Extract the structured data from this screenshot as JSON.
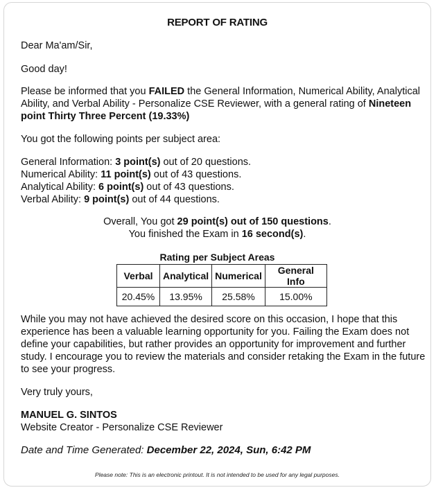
{
  "title": "REPORT OF RATING",
  "salutation": "Dear Ma'am/Sir,",
  "greeting": "Good day!",
  "intro": {
    "pre": "Please be informed that you ",
    "status": "FAILED",
    "mid": " the General Information, Numerical Ability, Analytical Ability, and Verbal Ability - Personalize CSE Reviewer, with a general rating of ",
    "rating_text": "Nineteen point Thirty Three Percent (19.33%)"
  },
  "points_intro": "You got the following points per subject area:",
  "subjects": [
    {
      "label": "General Information: ",
      "points": "3 point(s)",
      "rest": " out of 20 questions."
    },
    {
      "label": "Numerical Ability: ",
      "points": "11 point(s)",
      "rest": " out of 43 questions."
    },
    {
      "label": "Analytical Ability: ",
      "points": "6 point(s)",
      "rest": " out of 43 questions."
    },
    {
      "label": "Verbal Ability: ",
      "points": "9 point(s)",
      "rest": " out of 44 questions."
    }
  ],
  "overall": {
    "pre": "Overall, You got ",
    "score": "29 point(s) out of 150 questions",
    "post": ".",
    "time_pre": "You finished the Exam in ",
    "time": "16 second(s)",
    "time_post": "."
  },
  "rating_table": {
    "title": "Rating per Subject Areas",
    "headers": [
      "Verbal",
      "Analytical",
      "Numerical",
      "General Info"
    ],
    "values": [
      "20.45%",
      "13.95%",
      "25.58%",
      "15.00%"
    ]
  },
  "closing_paragraph": "While you may not have achieved the desired score on this occasion, I hope that this experience has been a valuable learning opportunity for you. Failing the Exam does not define your capabilities, but rather provides an opportunity for improvement and further study. I encourage you to review the materials and consider retaking the Exam in the future to see your progress.",
  "signoff": "Very truly yours,",
  "signer_name": "MANUEL G. SINTOS",
  "signer_title": "Website Creator - Personalize CSE Reviewer",
  "generated": {
    "label": "Date and Time Generated: ",
    "value": "December 22, 2024, Sun, 6:42 PM"
  },
  "note": "Please note: This is an electronic printout. It is not intended to be used for any legal purposes."
}
